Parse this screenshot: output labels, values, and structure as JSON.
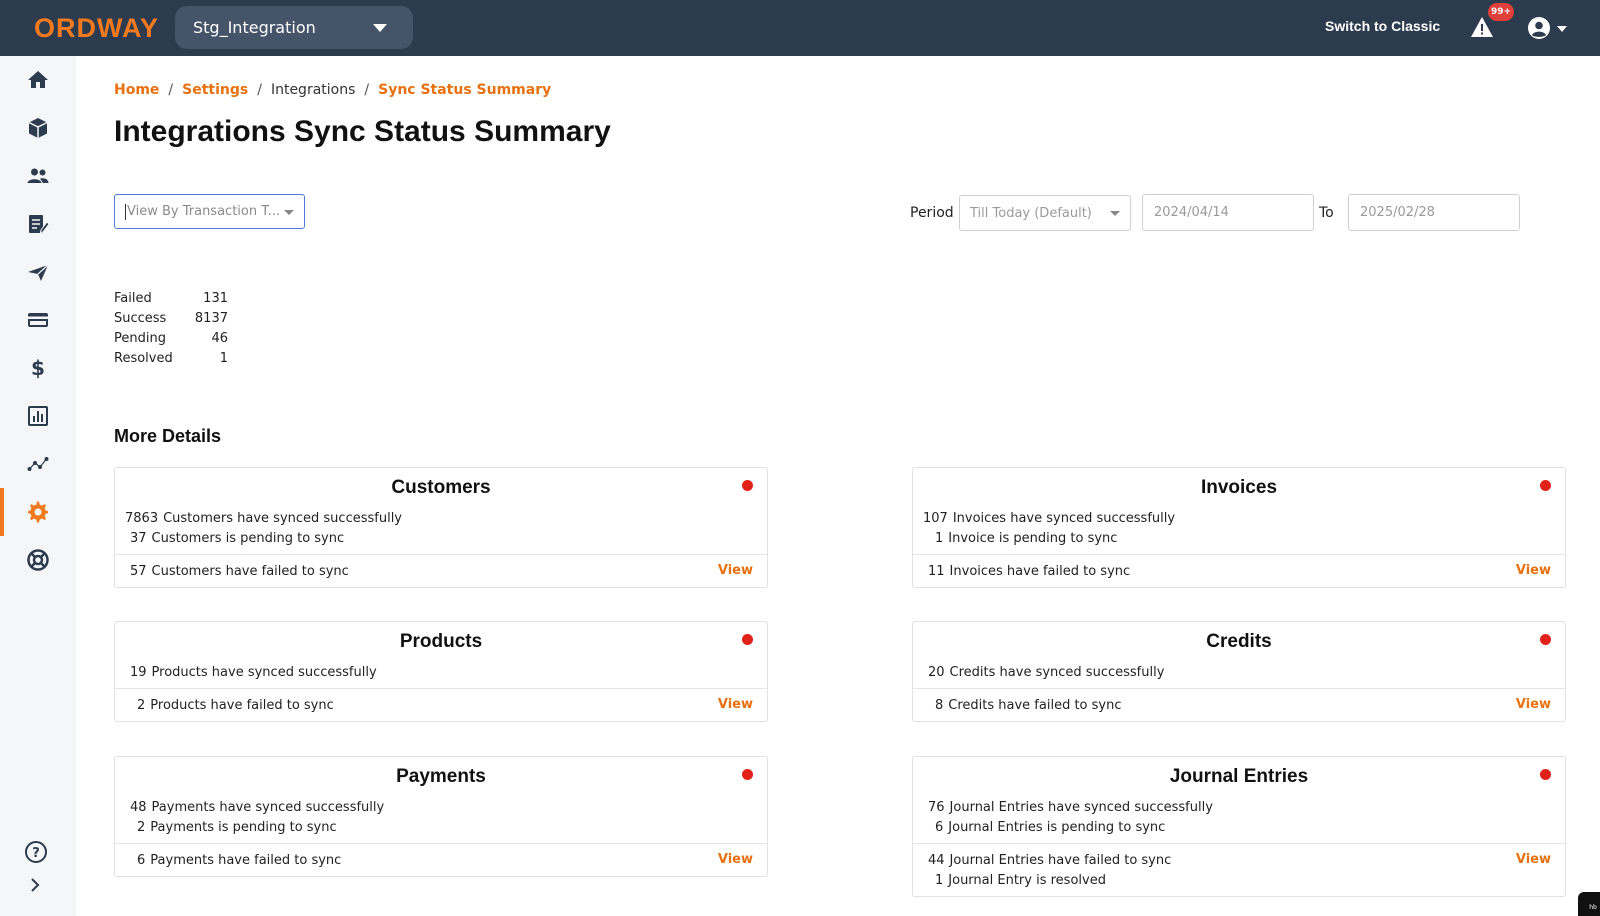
{
  "header": {
    "logo": "ORDWAY",
    "environment": "Stg_Integration",
    "switch_label": "Switch to Classic",
    "alert_badge": "99+"
  },
  "icons": {
    "sidebar": [
      "home-icon",
      "box-icon",
      "people-icon",
      "document-edit-icon",
      "send-icon",
      "credit-card-icon",
      "dollar-icon",
      "bar-chart-icon",
      "scatter-graph-icon",
      "gear-icon",
      "lifebuoy-icon"
    ],
    "help": "question-circle-icon",
    "expand": "chevron-right-icon"
  },
  "colors": {
    "accent": "#e8710f",
    "topbar": "#2d3b4e",
    "status_failed": "#e0221b"
  },
  "breadcrumb": {
    "home": "Home",
    "settings": "Settings",
    "integrations": "Integrations",
    "current": "Sync Status Summary"
  },
  "page": {
    "title": "Integrations Sync Status Summary"
  },
  "filters": {
    "view_placeholder": "View By Transaction T...",
    "period_label": "Period",
    "period_value": "Till Today (Default)",
    "from_date": "2024/04/14",
    "to_label": "To",
    "to_date": "2025/02/28"
  },
  "summary": [
    {
      "name": "Failed",
      "value": "131"
    },
    {
      "name": "Success",
      "value": "8137"
    },
    {
      "name": "Pending",
      "value": "46"
    },
    {
      "name": "Resolved",
      "value": "1"
    }
  ],
  "more_details": "More Details",
  "cards": {
    "customers": {
      "title": "Customers",
      "lines": [
        {
          "n": "7863",
          "text": "Customers have synced successfully"
        },
        {
          "n": "37",
          "text": "Customers is pending to sync"
        }
      ],
      "failed": {
        "n": "57",
        "text": "Customers have failed to sync"
      },
      "view": "View"
    },
    "invoices": {
      "title": "Invoices",
      "lines": [
        {
          "n": "107",
          "text": "Invoices have synced successfully"
        },
        {
          "n": "1",
          "text": "Invoice is pending to sync"
        }
      ],
      "failed": {
        "n": "11",
        "text": "Invoices have failed to sync"
      },
      "view": "View"
    },
    "products": {
      "title": "Products",
      "lines": [
        {
          "n": "19",
          "text": "Products have synced successfully"
        }
      ],
      "failed": {
        "n": "2",
        "text": "Products have failed to sync"
      },
      "view": "View"
    },
    "credits": {
      "title": "Credits",
      "lines": [
        {
          "n": "20",
          "text": "Credits have synced successfully"
        }
      ],
      "failed": {
        "n": "8",
        "text": "Credits have failed to sync"
      },
      "view": "View"
    },
    "payments": {
      "title": "Payments",
      "lines": [
        {
          "n": "48",
          "text": "Payments have synced successfully"
        },
        {
          "n": "2",
          "text": "Payments is pending to sync"
        }
      ],
      "failed": {
        "n": "6",
        "text": "Payments have failed to sync"
      },
      "view": "View"
    },
    "journal": {
      "title": "Journal Entries",
      "lines": [
        {
          "n": "76",
          "text": "Journal Entries have synced successfully"
        },
        {
          "n": "6",
          "text": "Journal Entries is pending to sync"
        }
      ],
      "failed": {
        "n": "44",
        "text": "Journal Entries have failed to sync"
      },
      "resolved": {
        "n": "1",
        "text": "Journal Entry is resolved"
      },
      "view": "View"
    }
  },
  "corner_tab": "hb"
}
